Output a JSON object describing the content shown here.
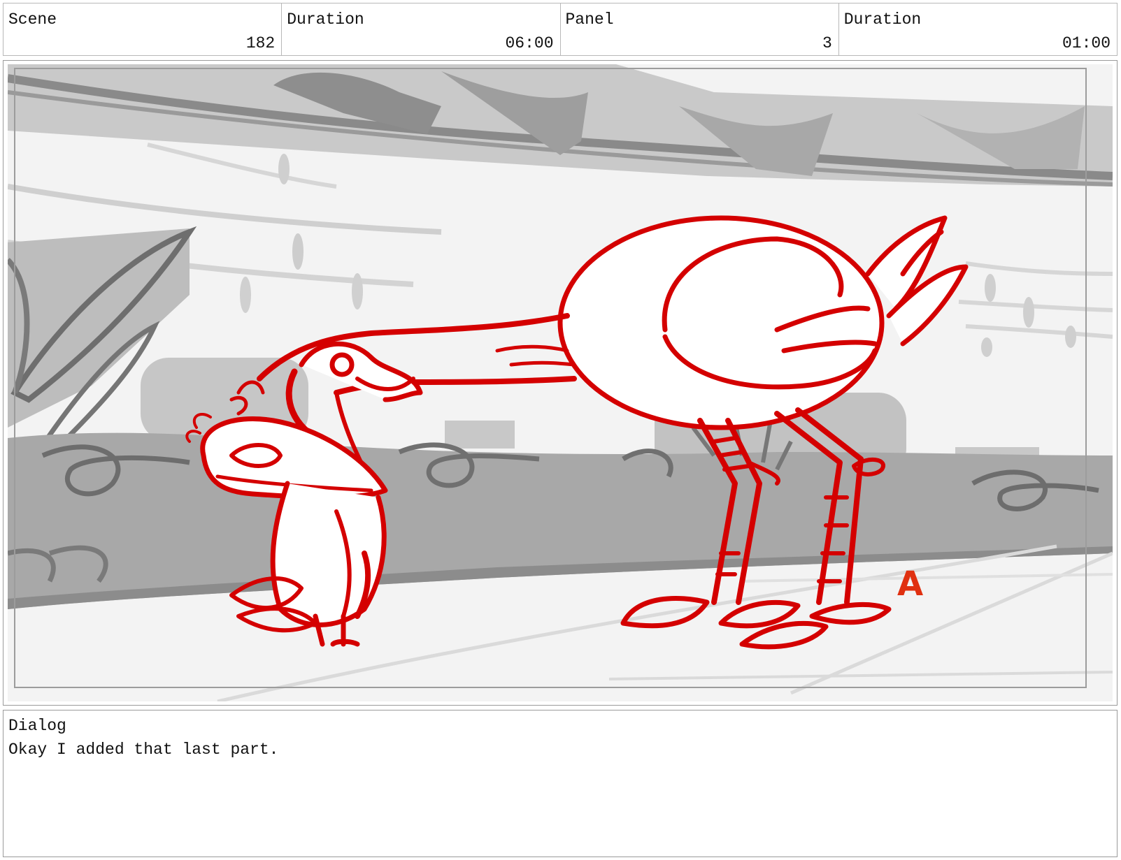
{
  "header": {
    "cells": [
      {
        "label": "Scene",
        "value": "182"
      },
      {
        "label": "Duration",
        "value": "06:00"
      },
      {
        "label": "Panel",
        "value": "3"
      },
      {
        "label": "Duration",
        "value": "01:00"
      }
    ]
  },
  "panel": {
    "annotation_letter": "A",
    "line_color": "#d40000",
    "background_tones": [
      "#f2f2f2",
      "#cfcfcf",
      "#a9a9a9",
      "#8a8a8a",
      "#6e6e6e"
    ]
  },
  "dialog": {
    "label": "Dialog",
    "text": "Okay I added that last part."
  }
}
